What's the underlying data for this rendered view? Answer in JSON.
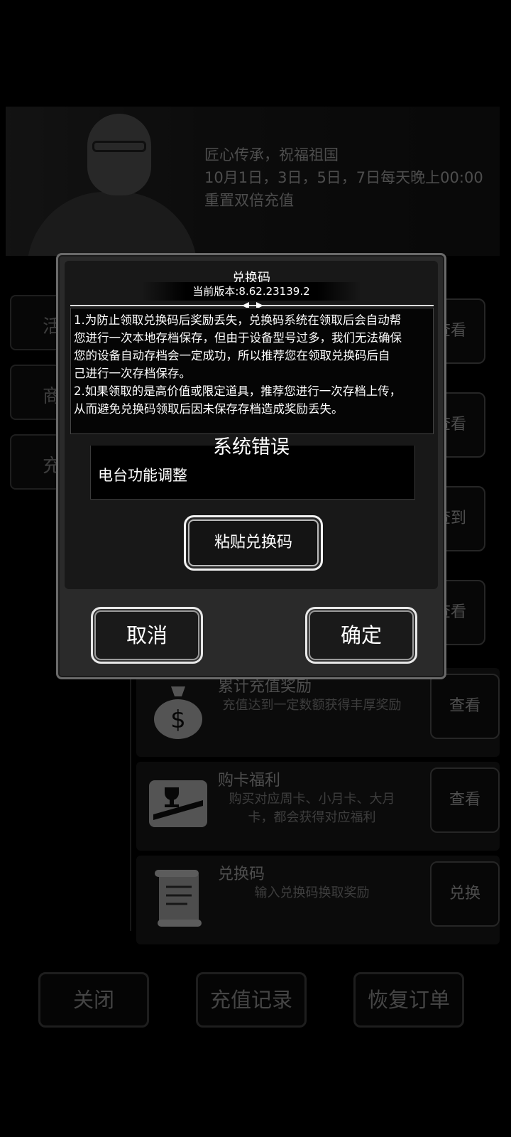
{
  "background": {
    "banner": {
      "lines": [
        "匠心传承，祝福祖国",
        "10月1日，3日，5日，7日每天晚上00:00",
        "重置双倍充值"
      ]
    },
    "nav": [
      {
        "label": "活"
      },
      {
        "label": "商"
      },
      {
        "label": "充"
      }
    ],
    "right_buttons": [
      "查看",
      "查看",
      "查到",
      "查看"
    ],
    "list": [
      {
        "title": "累计充值奖励",
        "desc": "充值达到一定数额获得丰厚奖励",
        "button": "查看",
        "icon": "money-bag-icon"
      },
      {
        "title": "购卡福利",
        "desc": "购买对应周卡、小月卡、大月卡，都会获得对应福利",
        "button": "查看",
        "icon": "card-trophy-icon"
      },
      {
        "title": "兑换码",
        "desc": "输入兑换码换取奖励",
        "button": "兑换",
        "icon": "scroll-icon"
      }
    ],
    "bottom": {
      "close": "关闭",
      "records": "充值记录",
      "restore": "恢复订单"
    }
  },
  "dialog": {
    "title": "兑换码",
    "version": "当前版本:8.62.23139.2",
    "notice_lines": [
      "1.为防止领取兑换码后奖励丢失，兑换码系统在领取后会自动帮",
      "您进行一次本地存档保存，但由于设备型号过多，我们无法确保",
      "您的设备自动存档会一定成功，所以推荐您在领取兑换码后自",
      "己进行一次存档保存。",
      "2.如果领取的是高价值或限定道具，推荐您进行一次存档上传，",
      "从而避免兑换码领取后因未保存存档造成奖励丢失。"
    ],
    "error_title": "系统错误",
    "error_message": "电台功能调整",
    "paste_button": "粘贴兑换码",
    "cancel_button": "取消",
    "confirm_button": "确定"
  }
}
